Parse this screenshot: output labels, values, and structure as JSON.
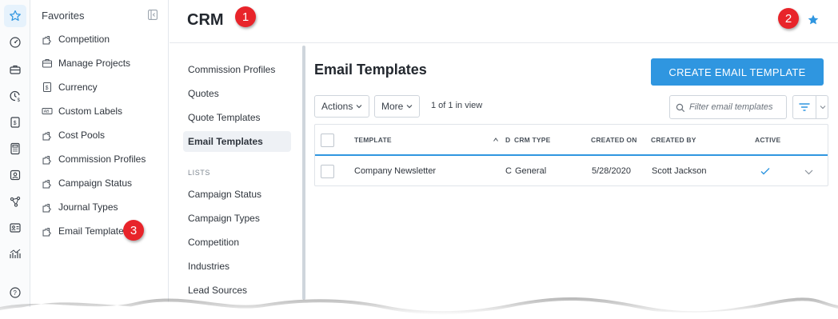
{
  "app": {
    "title": "CRM"
  },
  "colors": {
    "accent": "#2f96e0",
    "callout": "#e8242a",
    "rail_active_bg": "#e6f2fc"
  },
  "rail": {
    "icons": [
      "star-icon",
      "dashboard-gauge-icon",
      "briefcase-icon",
      "clock-dollar-icon",
      "dollar-document-icon",
      "calculator-icon",
      "person-badge-icon",
      "network-nodes-icon",
      "contact-card-icon",
      "trend-chart-icon",
      "help-icon"
    ]
  },
  "favorites": {
    "title": "Favorites",
    "items": [
      {
        "label": "Competition",
        "icon": "puzzle-icon"
      },
      {
        "label": "Manage Projects",
        "icon": "projects-icon"
      },
      {
        "label": "Currency",
        "icon": "currency-icon"
      },
      {
        "label": "Custom Labels",
        "icon": "label-ab-icon"
      },
      {
        "label": "Cost Pools",
        "icon": "puzzle-icon"
      },
      {
        "label": "Commission Profiles",
        "icon": "puzzle-icon"
      },
      {
        "label": "Campaign Status",
        "icon": "puzzle-icon"
      },
      {
        "label": "Journal Types",
        "icon": "puzzle-icon"
      },
      {
        "label": "Email Templates",
        "icon": "puzzle-icon"
      }
    ]
  },
  "callouts": [
    "1",
    "2",
    "3"
  ],
  "subnav": {
    "items": [
      "Commission Profiles",
      "Quotes",
      "Quote Templates",
      "Email Templates"
    ],
    "active": "Email Templates",
    "section_label": "LISTS",
    "list_items": [
      "Campaign Status",
      "Campaign Types",
      "Competition",
      "Industries",
      "Lead Sources"
    ]
  },
  "main": {
    "title": "Email Templates",
    "create_button": "CREATE EMAIL TEMPLATE",
    "toolbar": {
      "actions_label": "Actions",
      "more_label": "More",
      "view_count": "1 of 1 in view",
      "search_placeholder": "Filter email templates"
    },
    "table": {
      "columns": [
        "TEMPLATE",
        "D",
        "CRM TYPE",
        "CREATED ON",
        "CREATED BY",
        "ACTIVE"
      ],
      "rows": [
        {
          "template": "Company Newsletter",
          "d": "C",
          "crm_type": "General",
          "created_on": "5/28/2020",
          "created_by": "Scott Jackson",
          "active": true
        }
      ]
    }
  }
}
